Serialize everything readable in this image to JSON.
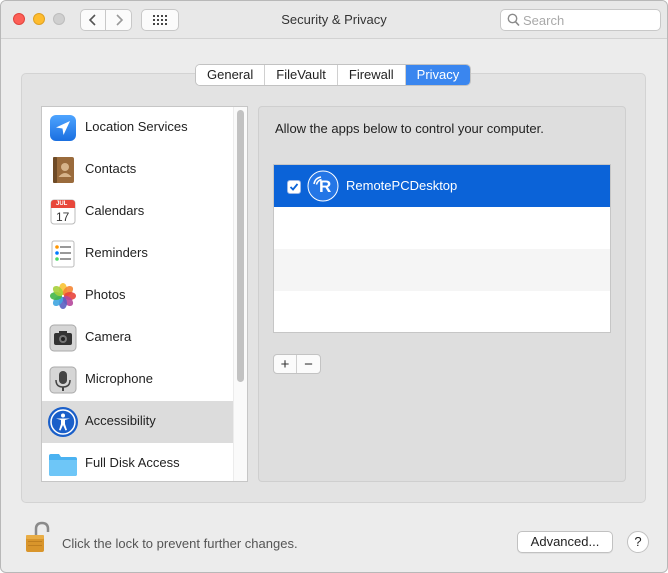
{
  "window": {
    "title": "Security & Privacy"
  },
  "search": {
    "placeholder": "Search",
    "value": ""
  },
  "tabs": [
    {
      "label": "General",
      "active": false
    },
    {
      "label": "FileVault",
      "active": false
    },
    {
      "label": "Firewall",
      "active": false
    },
    {
      "label": "Privacy",
      "active": true
    }
  ],
  "sidebar": {
    "items": [
      {
        "label": "Location Services",
        "icon": "location-arrow-icon"
      },
      {
        "label": "Contacts",
        "icon": "contacts-book-icon"
      },
      {
        "label": "Calendars",
        "icon": "calendar-icon",
        "icon_text": "17",
        "icon_month": "JUL"
      },
      {
        "label": "Reminders",
        "icon": "reminders-list-icon"
      },
      {
        "label": "Photos",
        "icon": "photos-flower-icon"
      },
      {
        "label": "Camera",
        "icon": "camera-icon"
      },
      {
        "label": "Microphone",
        "icon": "microphone-icon"
      },
      {
        "label": "Accessibility",
        "icon": "accessibility-icon",
        "selected": true
      },
      {
        "label": "Full Disk Access",
        "icon": "folder-icon"
      }
    ]
  },
  "main": {
    "heading": "Allow the apps below to control your computer.",
    "apps": [
      {
        "name": "RemotePCDesktop",
        "checked": true,
        "icon": "remotepc-icon",
        "icon_letter": "R"
      }
    ],
    "add_label": "+",
    "remove_label": "−"
  },
  "footer": {
    "lock_text": "Click the lock to prevent further changes.",
    "advanced_label": "Advanced...",
    "help_label": "?"
  },
  "colors": {
    "accent": "#3a86ef",
    "selection": "#0b63d8"
  }
}
